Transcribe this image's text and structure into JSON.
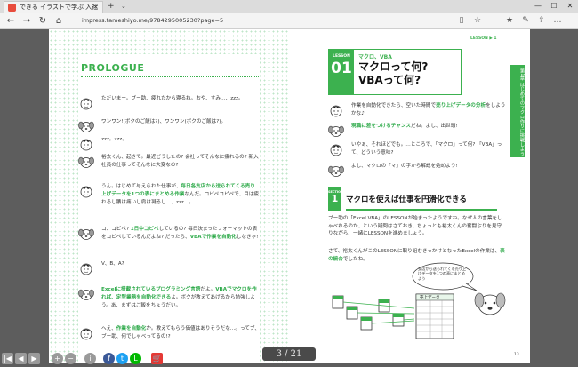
{
  "browser": {
    "tab_title": "できる イラストで学ぶ 入社",
    "url": "impress.tameshiyo.me/9784295005230?page=5",
    "new_tab": "+",
    "tab_close": "×"
  },
  "viewer": {
    "page_counter": "3 / 21"
  },
  "left_page": {
    "heading": "PROLOGUE",
    "dialog": [
      {
        "speaker": "boy",
        "text": "ただいまー。ブー助、疲れたから寝るね。おや、すみ…、zzz。"
      },
      {
        "speaker": "dog",
        "text": "ワンワン!(ボクのご飯は?)、ワンワン(ボクのご飯は?)。"
      },
      {
        "speaker": "boy",
        "text": "zzz。zzz。"
      },
      {
        "speaker": "dog",
        "text": "裕太くん、起きて。最近どうしたの? 会社ってそんなに疲れるの? 新入社員の仕事ってそんなに大変なの?"
      },
      {
        "speaker": "boy",
        "parts": [
          {
            "t": "うん。はじめて与えられた仕事が、"
          },
          {
            "t": "毎日各支店から送られてくる売り上げデータを1つの表にまとめる作業",
            "g": true
          },
          {
            "t": "なんだ。コピペコピペで、目は疲れるし腰は痛いし肩は凝るし…、zzz…。"
          }
        ]
      },
      {
        "speaker": "dog",
        "parts": [
          {
            "t": "コ、コピペ? "
          },
          {
            "t": "1日中コピペ",
            "g": true
          },
          {
            "t": "しているの? 毎日決まったフォーマットの表をコピペしているんだよね? だったら、"
          },
          {
            "t": "VBAで作業を自動化",
            "g": true
          },
          {
            "t": "しなきゃ!"
          }
        ]
      },
      {
        "speaker": "boy",
        "text": "V、B、A?"
      },
      {
        "speaker": "dog",
        "parts": [
          {
            "t": "Excelに搭載されているプログラミング言語",
            "g": true
          },
          {
            "t": "だよ。"
          },
          {
            "t": "VBAでマクロを作れば、定型業務を自動化できる",
            "g": true
          },
          {
            "t": "よ。ボクが教えてあげるから勉強しよう。あ、まずはご飯をちょうだい。"
          }
        ]
      },
      {
        "speaker": "boy",
        "parts": [
          {
            "t": "へえ、"
          },
          {
            "t": "作業を自動化",
            "g": true
          },
          {
            "t": "か。教えてもらう価値はありそうだな…。ってブ、ブー助、何でしゃべってるの!?"
          }
        ]
      }
    ]
  },
  "right_page": {
    "lesson_nav": "LESSON ▶ 1",
    "lesson_label": "LESSON",
    "lesson_number": "01",
    "lesson_subtitle": "マクロ、VBA",
    "lesson_title_line1": "マクロって何?",
    "lesson_title_line2": "VBAって何?",
    "side_tab": "第1章 はじめてのマクロ作りに挑戦しよう",
    "dialog": [
      {
        "speaker": "boy",
        "parts": [
          {
            "t": "作業を自動化できたら、空いた時間で"
          },
          {
            "t": "売り上げデータの分析",
            "g": true
          },
          {
            "t": "をしようかな♪"
          }
        ]
      },
      {
        "speaker": "dog",
        "parts": [
          {
            "t": "現職に差をつけるチャンス",
            "g": true
          },
          {
            "t": "だね。よし、出世頭!"
          }
        ]
      },
      {
        "speaker": "boy",
        "text": "いやぁ、それほどでも。…ところで、「マクロ」って何? 「VBA」って、どういう意味?"
      },
      {
        "speaker": "dog",
        "text": "よし、マクロの「マ」の字から解説を始めよう!"
      }
    ],
    "section_label": "SECTION",
    "section_number": "1",
    "section_title": "マクロを使えば仕事を円滑化できる",
    "paragraph1": "ブー助の「Excel VBA」のLESSONが始まったようですね。なぜ人の言葉をしゃべれるのか、という疑問はさておき、ちょっとも裕太くんの奮闘ぶりを見守りながら、一緒にLESSONを進めましょう。",
    "paragraph2_parts": [
      {
        "t": "さて、裕太くんがこのLESSONに取り組むきっかけとなったExcelの作業は、"
      },
      {
        "t": "表の統合",
        "g": true
      },
      {
        "t": "でしたね。"
      }
    ],
    "bubble_text": "支店から送られてくる売り上げデータを1つの表にまとめよう",
    "sheet_label": "売上データ",
    "page_number": "13"
  },
  "colors": {
    "accent": "#3cb14f",
    "viewer_bg": "#5d5d5d"
  }
}
